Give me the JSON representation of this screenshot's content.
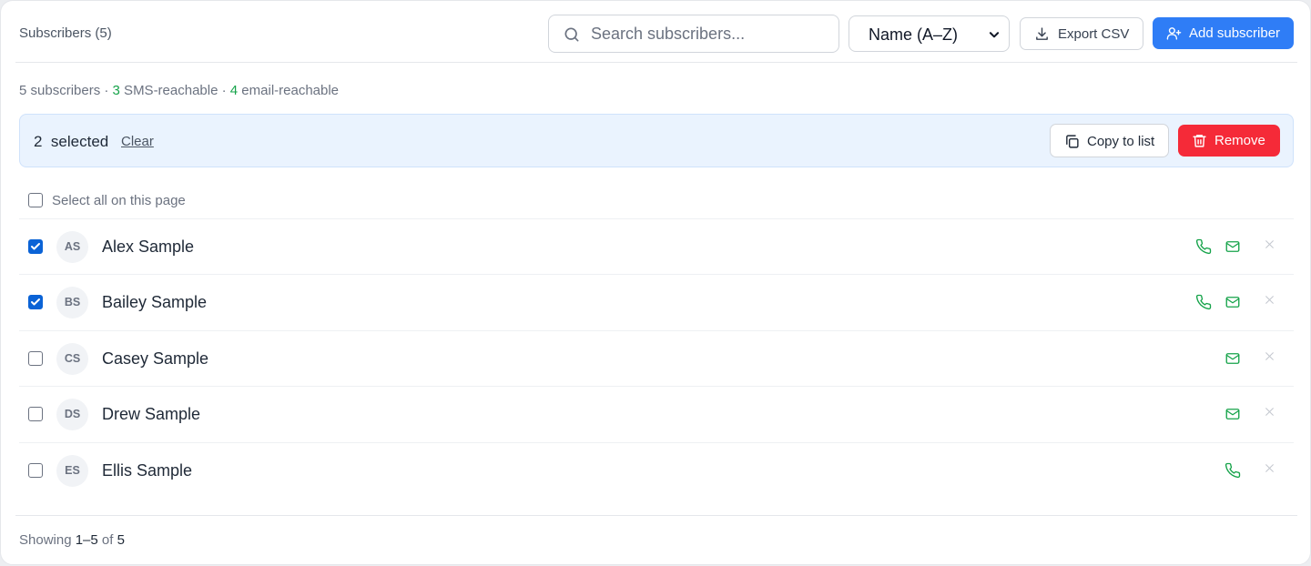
{
  "header": {
    "title": "Subscribers (5)",
    "search_placeholder": "Search subscribers...",
    "sort_value": "Name (A–Z)",
    "export_label": "Export CSV",
    "add_label": "Add subscriber",
    "accent": "#2f7df6"
  },
  "summary": {
    "total": "5 subscribers",
    "sep1": " · ",
    "sms_count": "3",
    "sms_label": " SMS-reachable",
    "sep2": " · ",
    "email_count": "4",
    "email_label": " email-reachable"
  },
  "selection": {
    "count": "2",
    "selected_label": "selected",
    "clear_label": "Clear",
    "copy_label": "Copy to list",
    "remove_label": "Remove",
    "danger": "#f52a38"
  },
  "select_all_label": "Select all on this page",
  "subscribers": [
    {
      "initials": "AS",
      "name": "Alex Sample",
      "checked": true,
      "sms": true,
      "email": true
    },
    {
      "initials": "BS",
      "name": "Bailey Sample",
      "checked": true,
      "sms": true,
      "email": true
    },
    {
      "initials": "CS",
      "name": "Casey Sample",
      "checked": false,
      "sms": false,
      "email": true
    },
    {
      "initials": "DS",
      "name": "Drew Sample",
      "checked": false,
      "sms": false,
      "email": true
    },
    {
      "initials": "ES",
      "name": "Ellis Sample",
      "checked": false,
      "sms": true,
      "email": false
    }
  ],
  "footer": {
    "showing_label": "Showing",
    "range": "1–5",
    "of_label": "of",
    "total": "5"
  },
  "icons": {
    "reachable_color": "#16a34a"
  }
}
